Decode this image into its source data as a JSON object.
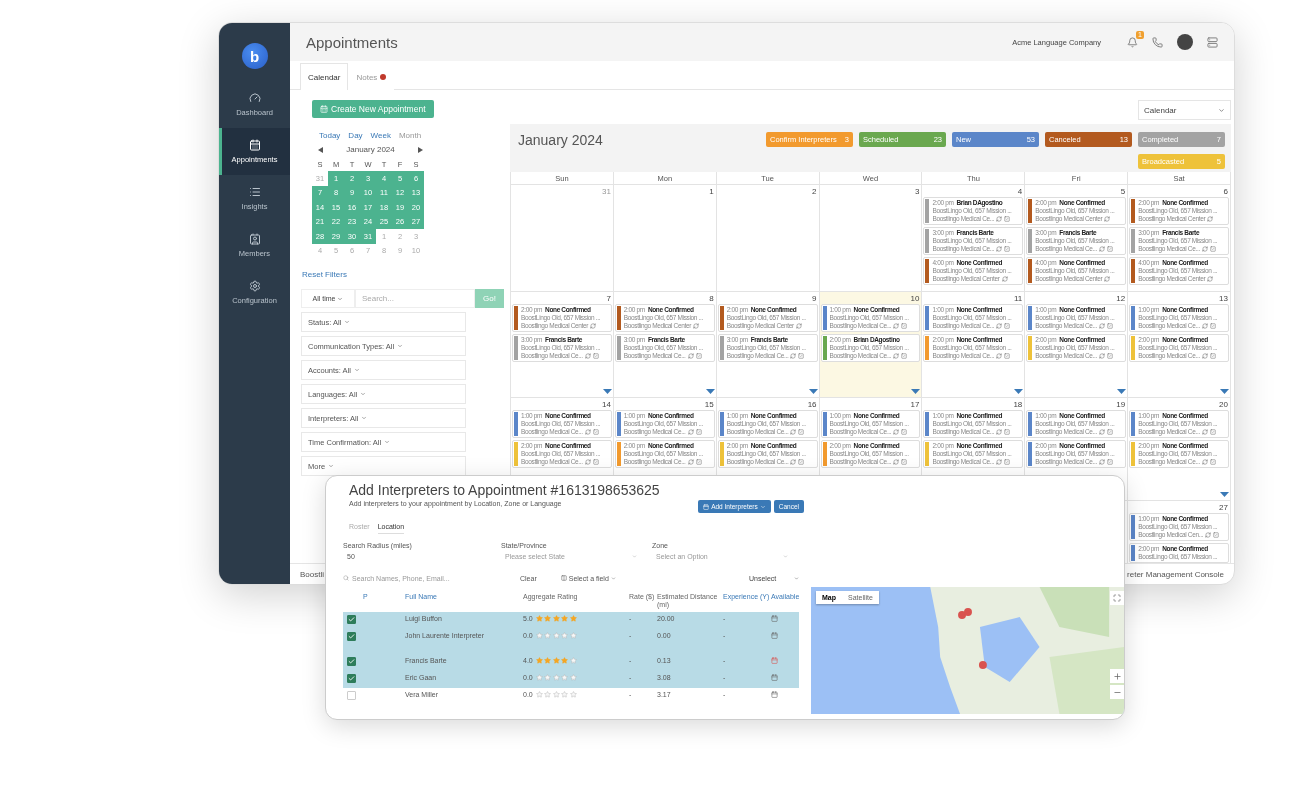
{
  "sidebar": {
    "logo": "b",
    "items": [
      {
        "label": "Dashboard",
        "kind": "gauge",
        "selected": false
      },
      {
        "label": "Appointments",
        "kind": "calendar",
        "selected": true
      },
      {
        "label": "Insights",
        "kind": "list",
        "selected": false
      },
      {
        "label": "Members",
        "kind": "card",
        "selected": false
      },
      {
        "label": "Configuration",
        "kind": "gear",
        "selected": false
      }
    ]
  },
  "header": {
    "title": "Appointments",
    "company": "Acme Language Company",
    "notification_count": "1"
  },
  "tabs": [
    {
      "label": "Calendar",
      "selected": true,
      "unread": false
    },
    {
      "label": "Notes",
      "selected": false,
      "unread": true
    }
  ],
  "create_button": "Create New Appointment",
  "mini_calendar": {
    "views": [
      {
        "label": "Today",
        "disabled": false
      },
      {
        "label": "Day",
        "disabled": false
      },
      {
        "label": "Week",
        "disabled": false
      },
      {
        "label": "Month",
        "disabled": true
      }
    ],
    "month": "January 2024",
    "weekdays": [
      "S",
      "M",
      "T",
      "W",
      "T",
      "F",
      "S"
    ],
    "weeks": [
      [
        {
          "label": "31",
          "in_range": false
        },
        {
          "label": "1",
          "in_range": true
        },
        {
          "label": "2",
          "in_range": true
        },
        {
          "label": "3",
          "in_range": true
        },
        {
          "label": "4",
          "in_range": true
        },
        {
          "label": "5",
          "in_range": true
        },
        {
          "label": "6",
          "in_range": true
        }
      ],
      [
        {
          "label": "7",
          "in_range": true
        },
        {
          "label": "8",
          "in_range": true
        },
        {
          "label": "9",
          "in_range": true
        },
        {
          "label": "10",
          "in_range": true
        },
        {
          "label": "11",
          "in_range": true
        },
        {
          "label": "12",
          "in_range": true
        },
        {
          "label": "13",
          "in_range": true
        }
      ],
      [
        {
          "label": "14",
          "in_range": true
        },
        {
          "label": "15",
          "in_range": true
        },
        {
          "label": "16",
          "in_range": true
        },
        {
          "label": "17",
          "in_range": true
        },
        {
          "label": "18",
          "in_range": true
        },
        {
          "label": "19",
          "in_range": true
        },
        {
          "label": "20",
          "in_range": true
        }
      ],
      [
        {
          "label": "21",
          "in_range": true
        },
        {
          "label": "22",
          "in_range": true
        },
        {
          "label": "23",
          "in_range": true
        },
        {
          "label": "24",
          "in_range": true
        },
        {
          "label": "25",
          "in_range": true
        },
        {
          "label": "26",
          "in_range": true
        },
        {
          "label": "27",
          "in_range": true
        }
      ],
      [
        {
          "label": "28",
          "in_range": true
        },
        {
          "label": "29",
          "in_range": true
        },
        {
          "label": "30",
          "in_range": true
        },
        {
          "label": "31",
          "in_range": true
        },
        {
          "label": "1",
          "in_range": false
        },
        {
          "label": "2",
          "in_range": false
        },
        {
          "label": "3",
          "in_range": false
        }
      ],
      [
        {
          "label": "4",
          "in_range": false
        },
        {
          "label": "5",
          "in_range": false
        },
        {
          "label": "6",
          "in_range": false
        },
        {
          "label": "7",
          "in_range": false
        },
        {
          "label": "8",
          "in_range": false
        },
        {
          "label": "9",
          "in_range": false
        },
        {
          "label": "10",
          "in_range": false
        }
      ]
    ]
  },
  "reset_filters": "Reset Filters",
  "search": {
    "range": "All time",
    "placeholder": "Search...",
    "button": "Go!"
  },
  "filters": [
    "Status: All",
    "Communication Types: All",
    "Accounts: All",
    "Languages: All",
    "Interpreters: All",
    "Time Confirmation: All",
    "More"
  ],
  "view_select": "Calendar",
  "calendar": {
    "title": "January 2024",
    "legend": [
      {
        "label": "Confirm Interpreters",
        "count": "3",
        "color": "#f29a2e"
      },
      {
        "label": "Scheduled",
        "count": "23",
        "color": "#6aa84f"
      },
      {
        "label": "New",
        "count": "53",
        "color": "#5b86c9"
      },
      {
        "label": "Canceled",
        "count": "13",
        "color": "#b35a1f"
      },
      {
        "label": "Completed",
        "count": "7",
        "color": "#a3a3a3"
      },
      {
        "label": "Broadcasted",
        "count": "5",
        "color": "#eec23a"
      }
    ],
    "weekdays": [
      "Sun",
      "Mon",
      "Tue",
      "Wed",
      "Thu",
      "Fri",
      "Sat"
    ],
    "weeks": [
      [
        {
          "date": "31",
          "muted": true,
          "today": false,
          "more": false
        },
        {
          "date": "1",
          "muted": false,
          "today": false,
          "more": false
        },
        {
          "date": "2",
          "muted": false,
          "today": false,
          "more": false
        },
        {
          "date": "3",
          "muted": false,
          "today": false,
          "more": false
        },
        {
          "date": "4",
          "muted": false,
          "today": false,
          "more": false,
          "events": [
            {
              "time": "2:00 pm",
              "name": "Brian DAgostino",
              "address": "BoostLingo Old, 657 Mission ...",
              "place": "Boostlingo Medical Ce...",
              "color": "#a3a3a3",
              "flagged": true
            },
            {
              "time": "3:00 pm",
              "name": "Francis Barte",
              "address": "BoostLingo Old, 657 Mission ...",
              "place": "Boostlingo Medical Ce...",
              "color": "#a3a3a3",
              "flagged": true
            },
            {
              "time": "4:00 pm",
              "name": "None Confirmed",
              "address": "BoostLingo Old, 657 Mission ...",
              "place": "Boostlingo Medical Center",
              "color": "#b35a1f",
              "flagged": false
            }
          ]
        },
        {
          "date": "5",
          "muted": false,
          "today": false,
          "more": false,
          "events": [
            {
              "time": "2:00 pm",
              "name": "None Confirmed",
              "address": "BoostLingo Old, 657 Mission ...",
              "place": "Boostlingo Medical Center",
              "color": "#b35a1f",
              "flagged": false
            },
            {
              "time": "3:00 pm",
              "name": "Francis Barte",
              "address": "BoostLingo Old, 657 Mission ...",
              "place": "Boostlingo Medical Ce...",
              "color": "#a3a3a3",
              "flagged": true
            },
            {
              "time": "4:00 pm",
              "name": "None Confirmed",
              "address": "BoostLingo Old, 657 Mission ...",
              "place": "Boostlingo Medical Center",
              "color": "#b35a1f",
              "flagged": false
            }
          ]
        },
        {
          "date": "6",
          "muted": false,
          "today": false,
          "more": false,
          "events": [
            {
              "time": "2:00 pm",
              "name": "None Confirmed",
              "address": "BoostLingo Old, 657 Mission ...",
              "place": "Boostlingo Medical Center",
              "color": "#b35a1f",
              "flagged": false
            },
            {
              "time": "3:00 pm",
              "name": "Francis Barte",
              "address": "BoostLingo Old, 657 Mission ...",
              "place": "Boostlingo Medical Ce...",
              "color": "#a3a3a3",
              "flagged": true
            },
            {
              "time": "4:00 pm",
              "name": "None Confirmed",
              "address": "BoostLingo Old, 657 Mission ...",
              "place": "Boostlingo Medical Center",
              "color": "#b35a1f",
              "flagged": false
            }
          ]
        }
      ],
      [
        {
          "date": "7",
          "muted": false,
          "today": false,
          "more": true,
          "events": [
            {
              "time": "2:00 pm",
              "name": "None Confirmed",
              "address": "BoostLingo Old, 657 Mission ...",
              "place": "Boostlingo Medical Center",
              "color": "#b35a1f",
              "flagged": false
            },
            {
              "time": "3:00 pm",
              "name": "Francis Barte",
              "address": "BoostLingo Old, 657 Mission ...",
              "place": "Boostlingo Medical Ce...",
              "color": "#a3a3a3",
              "flagged": true
            }
          ]
        },
        {
          "date": "8",
          "muted": false,
          "today": false,
          "more": true,
          "events": [
            {
              "time": "2:00 pm",
              "name": "None Confirmed",
              "address": "BoostLingo Old, 657 Mission ...",
              "place": "Boostlingo Medical Center",
              "color": "#b35a1f",
              "flagged": false
            },
            {
              "time": "3:00 pm",
              "name": "Francis Barte",
              "address": "BoostLingo Old, 657 Mission ...",
              "place": "Boostlingo Medical Ce...",
              "color": "#a3a3a3",
              "flagged": true
            }
          ]
        },
        {
          "date": "9",
          "muted": false,
          "today": false,
          "more": true,
          "events": [
            {
              "time": "2:00 pm",
              "name": "None Confirmed",
              "address": "BoostLingo Old, 657 Mission ...",
              "place": "Boostlingo Medical Center",
              "color": "#b35a1f",
              "flagged": false
            },
            {
              "time": "3:00 pm",
              "name": "Francis Barte",
              "address": "BoostLingo Old, 657 Mission ...",
              "place": "Boostlingo Medical Ce...",
              "color": "#a3a3a3",
              "flagged": true
            }
          ]
        },
        {
          "date": "10",
          "muted": false,
          "today": true,
          "more": true,
          "events": [
            {
              "time": "1:00 pm",
              "name": "None Confirmed",
              "address": "BoostLingo Old, 657 Mission ...",
              "place": "Boostlingo Medical Ce...",
              "color": "#5b86c9",
              "flagged": true
            },
            {
              "time": "2:00 pm",
              "name": "Brian DAgostino",
              "address": "BoostLingo Old, 657 Mission ...",
              "place": "Boostlingo Medical Ce...",
              "color": "#6aa84f",
              "flagged": true
            }
          ]
        },
        {
          "date": "11",
          "muted": false,
          "today": false,
          "more": true,
          "events": [
            {
              "time": "1:00 pm",
              "name": "None Confirmed",
              "address": "BoostLingo Old, 657 Mission ...",
              "place": "Boostlingo Medical Ce...",
              "color": "#5b86c9",
              "flagged": true
            },
            {
              "time": "2:00 pm",
              "name": "None Confirmed",
              "address": "BoostLingo Old, 657 Mission ...",
              "place": "Boostlingo Medical Ce...",
              "color": "#f29a2e",
              "flagged": true
            }
          ]
        },
        {
          "date": "12",
          "muted": false,
          "today": false,
          "more": true,
          "events": [
            {
              "time": "1:00 pm",
              "name": "None Confirmed",
              "address": "BoostLingo Old, 657 Mission ...",
              "place": "Boostlingo Medical Ce...",
              "color": "#5b86c9",
              "flagged": true
            },
            {
              "time": "2:00 pm",
              "name": "None Confirmed",
              "address": "BoostLingo Old, 657 Mission ...",
              "place": "Boostlingo Medical Ce...",
              "color": "#eec23a",
              "flagged": true
            }
          ]
        },
        {
          "date": "13",
          "muted": false,
          "today": false,
          "more": true,
          "events": [
            {
              "time": "1:00 pm",
              "name": "None Confirmed",
              "address": "BoostLingo Old, 657 Mission ...",
              "place": "Boostlingo Medical Ce...",
              "color": "#5b86c9",
              "flagged": true
            },
            {
              "time": "2:00 pm",
              "name": "None Confirmed",
              "address": "BoostLingo Old, 657 Mission ...",
              "place": "Boostlingo Medical Ce...",
              "color": "#eec23a",
              "flagged": true
            }
          ]
        }
      ],
      [
        {
          "date": "14",
          "muted": false,
          "today": false,
          "more": false,
          "events": [
            {
              "time": "1:00 pm",
              "name": "None Confirmed",
              "address": "BoostLingo Old, 657 Mission ...",
              "place": "Boostlingo Medical Ce...",
              "color": "#5b86c9",
              "flagged": true
            },
            {
              "time": "2:00 pm",
              "name": "None Confirmed",
              "address": "BoostLingo Old, 657 Mission ...",
              "place": "Boostlingo Medical Ce...",
              "color": "#eec23a",
              "flagged": true
            }
          ]
        },
        {
          "date": "15",
          "muted": false,
          "today": false,
          "more": false,
          "events": [
            {
              "time": "1:00 pm",
              "name": "None Confirmed",
              "address": "BoostLingo Old, 657 Mission ...",
              "place": "Boostlingo Medical Ce...",
              "color": "#5b86c9",
              "flagged": true
            },
            {
              "time": "2:00 pm",
              "name": "None Confirmed",
              "address": "BoostLingo Old, 657 Mission ...",
              "place": "Boostlingo Medical Ce...",
              "color": "#f29a2e",
              "flagged": true
            }
          ]
        },
        {
          "date": "16",
          "muted": false,
          "today": false,
          "more": false,
          "events": [
            {
              "time": "1:00 pm",
              "name": "None Confirmed",
              "address": "BoostLingo Old, 657 Mission ...",
              "place": "Boostlingo Medical Ce...",
              "color": "#5b86c9",
              "flagged": true
            },
            {
              "time": "2:00 pm",
              "name": "None Confirmed",
              "address": "BoostLingo Old, 657 Mission ...",
              "place": "Boostlingo Medical Ce...",
              "color": "#eec23a",
              "flagged": true
            }
          ]
        },
        {
          "date": "17",
          "muted": false,
          "today": false,
          "more": false,
          "events": [
            {
              "time": "1:00 pm",
              "name": "None Confirmed",
              "address": "BoostLingo Old, 657 Mission ...",
              "place": "Boostlingo Medical Ce...",
              "color": "#5b86c9",
              "flagged": true
            },
            {
              "time": "2:00 pm",
              "name": "None Confirmed",
              "address": "BoostLingo Old, 657 Mission ...",
              "place": "Boostlingo Medical Ce...",
              "color": "#f29a2e",
              "flagged": true
            }
          ]
        },
        {
          "date": "18",
          "muted": false,
          "today": false,
          "more": false,
          "events": [
            {
              "time": "1:00 pm",
              "name": "None Confirmed",
              "address": "BoostLingo Old, 657 Mission ...",
              "place": "Boostlingo Medical Ce...",
              "color": "#5b86c9",
              "flagged": true
            },
            {
              "time": "2:00 pm",
              "name": "None Confirmed",
              "address": "BoostLingo Old, 657 Mission ...",
              "place": "Boostlingo Medical Ce...",
              "color": "#eec23a",
              "flagged": true
            }
          ]
        },
        {
          "date": "19",
          "muted": false,
          "today": false,
          "more": false,
          "events": [
            {
              "time": "1:00 pm",
              "name": "None Confirmed",
              "address": "BoostLingo Old, 657 Mission ...",
              "place": "Boostlingo Medical Ce...",
              "color": "#5b86c9",
              "flagged": true
            },
            {
              "time": "2:00 pm",
              "name": "None Confirmed",
              "address": "BoostLingo Old, 657 Mission ...",
              "place": "Boostlingo Medical Ce...",
              "color": "#5b86c9",
              "flagged": true
            }
          ]
        },
        {
          "date": "20",
          "muted": false,
          "today": false,
          "more": true,
          "events": [
            {
              "time": "1:00 pm",
              "name": "None Confirmed",
              "address": "BoostLingo Old, 657 Mission ...",
              "place": "Boostlingo Medical Ce...",
              "color": "#5b86c9",
              "flagged": true
            },
            {
              "time": "2:00 pm",
              "name": "None Confirmed",
              "address": "BoostLingo Old, 657 Mission ...",
              "place": "Boostlingo Medical Ce...",
              "color": "#eec23a",
              "flagged": true
            }
          ]
        }
      ],
      [
        {
          "date": "27",
          "muted": false,
          "today": false,
          "more": false,
          "events": [
            {
              "time": "1:00 pm",
              "name": "None Confirmed",
              "address": "BoostLingo Old, 657 Mission ...",
              "place": "Boostlingo Medical Cen...",
              "color": "#5b86c9",
              "flagged": true
            },
            {
              "time": "2:00 pm",
              "name": "None Confirmed",
              "address": "BoostLingo Old, 657 Mission ...",
              "color": "#5b86c9"
            }
          ]
        }
      ]
    ]
  },
  "footer": {
    "left": "Boostli",
    "right": "reter Management Console"
  },
  "modal": {
    "title": "Add Interpreters to Appointment #1613198653625",
    "subtitle": "Add interpreters to your appointment by Location, Zone or Language",
    "add_button": "Add Interpreters",
    "cancel_button": "Cancel",
    "tabs": [
      {
        "label": "Roster",
        "selected": false
      },
      {
        "label": "Location",
        "selected": true
      }
    ],
    "fields": [
      {
        "label": "Search Radius (miles)",
        "kind": "text",
        "value": "50"
      },
      {
        "label": "State/Province",
        "kind": "select",
        "placeholder": "Please select State"
      },
      {
        "label": "Zone",
        "kind": "select",
        "placeholder": "Select an Option"
      }
    ],
    "search_placeholder": "Search Names, Phone, Email...",
    "clear_button": "Clear",
    "field_select": "Select a field",
    "unselect": "Unselect",
    "columns": [
      "P",
      "Full Name",
      "Aggregate Rating",
      "Rate ($)",
      "Estimated Distance (mi)",
      "Experience (Y)",
      "Available"
    ],
    "rows": [
      {
        "checked": true,
        "name": "Luigi Buffon",
        "rating": "5.0",
        "stars": 5,
        "rate": "-",
        "distance": "20.00",
        "experience": "-",
        "conflict": false
      },
      {
        "checked": true,
        "name": "John Laurente Interpreter",
        "rating": "0.0",
        "stars": 0,
        "rate": "-",
        "distance": "0.00",
        "experience": "-",
        "conflict": false
      },
      {
        "checked": true,
        "name": "Francis Barte",
        "rating": "4.0",
        "stars": 4,
        "rate": "-",
        "distance": "0.13",
        "experience": "-",
        "conflict": true
      },
      {
        "checked": true,
        "name": "Eric Gaan",
        "rating": "0.0",
        "stars": 0,
        "rate": "-",
        "distance": "3.08",
        "experience": "-",
        "conflict": false
      },
      {
        "checked": false,
        "name": "Vera Miller",
        "rating": "0.0",
        "stars": 0,
        "rate": "-",
        "distance": "3.17",
        "experience": "-",
        "conflict": false
      }
    ],
    "map_types": [
      {
        "label": "Map",
        "selected": true
      },
      {
        "label": "Satellite",
        "selected": false
      }
    ]
  }
}
